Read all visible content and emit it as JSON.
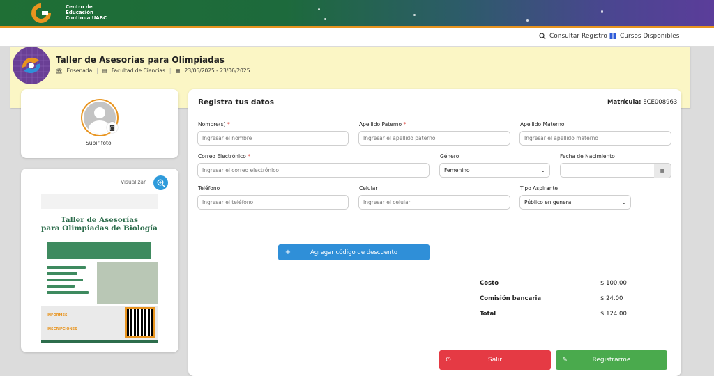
{
  "header": {
    "org_name_line1": "Centro de",
    "org_name_line2": "Educación",
    "org_name_line3": "Continua UABC"
  },
  "nav": {
    "consultar_label": "Consultar Registro",
    "cursos_label": "Cursos Disponibles",
    "consultar_icon": "search-icon",
    "cursos_icon": "book-icon"
  },
  "course": {
    "title": "Taller de Asesorías para Olimpiadas",
    "campus": "Ensenada",
    "faculty": "Facultad de Ciencias",
    "dates": "23/06/2025 - 23/06/2025"
  },
  "profile": {
    "upload_label": "Subir foto"
  },
  "poster_card": {
    "visualizar_label": "Visualizar",
    "poster_title_line1": "Taller de Asesorías",
    "poster_title_line2": "para Olimpiadas de Biología",
    "poster_informes": "INFORMES",
    "poster_inscripciones": "INSCRIPCIONES"
  },
  "form": {
    "title": "Registra tus datos",
    "matricula_label": "Matrícula:",
    "matricula_value": "ECE008963",
    "fields": {
      "nombre": {
        "label": "Nombre(s)",
        "required": "*",
        "placeholder": "Ingresar el nombre"
      },
      "apellido_paterno": {
        "label": "Apellido Paterno",
        "required": "*",
        "placeholder": "Ingresar el apellido paterno"
      },
      "apellido_materno": {
        "label": "Apellido Materno",
        "placeholder": "Ingresar el apellido materno"
      },
      "correo": {
        "label": "Correo Electrónico",
        "required": "*",
        "placeholder": "Ingresar el correo electrónico"
      },
      "genero": {
        "label": "Género",
        "value": "Femenino"
      },
      "fecha": {
        "label": "Fecha de Nacimiento",
        "value": ""
      },
      "telefono": {
        "label": "Teléfono",
        "placeholder": "Ingresar el teléfono"
      },
      "celular": {
        "label": "Celular",
        "placeholder": "Ingresar el celular"
      },
      "tipo": {
        "label": "Tipo Aspirante",
        "value": "Público en general"
      }
    },
    "discount_label": "Agregar código de descuento"
  },
  "costs": {
    "costo_label": "Costo",
    "costo_value": "$ 100.00",
    "comision_label": "Comisión bancaria",
    "comision_value": "$ 24.00",
    "total_label": "Total",
    "total_value": "$ 124.00"
  },
  "actions": {
    "salir_label": "Salir",
    "registrarme_label": "Registrarme"
  },
  "colors": {
    "accent_orange": "#e8941f",
    "primary_blue": "#2f8fd8",
    "danger_red": "#e53a44",
    "success_green": "#4aaa4d",
    "banner_yellow": "#fbf6c5"
  }
}
